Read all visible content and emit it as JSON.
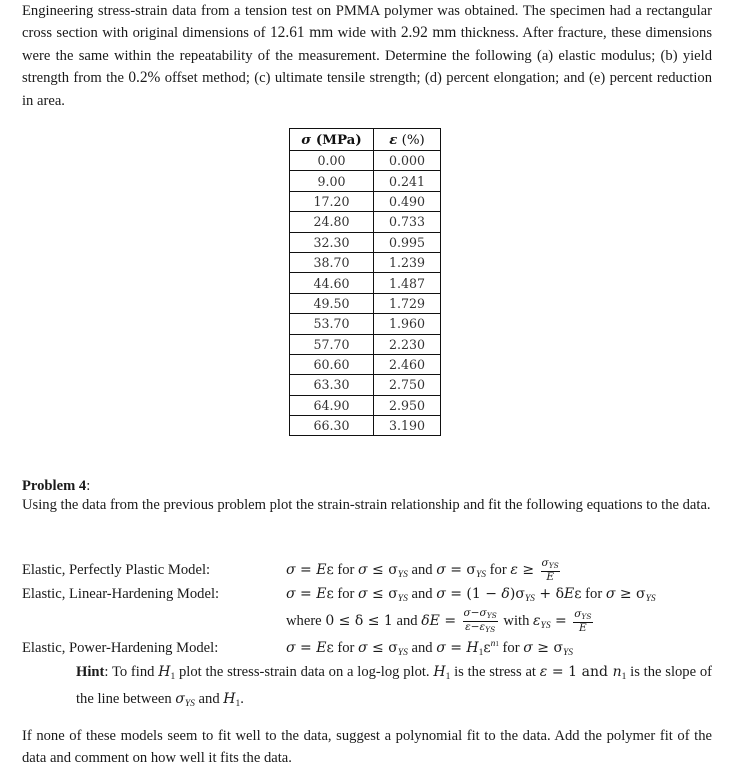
{
  "problem3": {
    "text_parts": [
      "Engineering stress-strain data from a tension test on PMMA polymer was obtained.  The specimen had a rectangular cross section with original dimensions of ",
      "12.61 mm",
      " wide with ",
      "2.92 mm",
      " thickness.  After fracture, these dimensions were the same within the repeatability of the measurement.  Determine the following (a) elastic modulus; (b) yield strength from the ",
      "0.2%",
      " offset method; (c) ultimate tensile strength; (d) percent elongation; and (e) percent reduction in area."
    ]
  },
  "table": {
    "headers": {
      "stress_symbol": "σ",
      "stress_unit": " (MPa)",
      "strain_symbol": "ε",
      "strain_unit": " (%)"
    },
    "rows": [
      [
        "0.00",
        "0.000"
      ],
      [
        "9.00",
        "0.241"
      ],
      [
        "17.20",
        "0.490"
      ],
      [
        "24.80",
        "0.733"
      ],
      [
        "32.30",
        "0.995"
      ],
      [
        "38.70",
        "1.239"
      ],
      [
        "44.60",
        "1.487"
      ],
      [
        "49.50",
        "1.729"
      ],
      [
        "53.70",
        "1.960"
      ],
      [
        "57.70",
        "2.230"
      ],
      [
        "60.60",
        "2.460"
      ],
      [
        "63.30",
        "2.750"
      ],
      [
        "64.90",
        "2.950"
      ],
      [
        "66.30",
        "3.190"
      ]
    ]
  },
  "problem4": {
    "title": "Problem 4",
    "title_suffix": ":",
    "intro": "Using the data from the previous problem plot the strain-strain relationship and fit the following equations to the data.",
    "models": [
      {
        "label": "Elastic, Perfectly Plastic Model:"
      },
      {
        "label": "Elastic, Linear-Hardening Model:"
      },
      {
        "label": "Elastic, Power-Hardening Model:"
      }
    ],
    "hint": {
      "label": "Hint",
      "parts": [
        ":  To find ",
        " plot the stress-strain data on a log-log plot.  ",
        " is the stress at ",
        " = 1 and ",
        " is the slope of the line between ",
        " and ",
        "."
      ]
    },
    "closing": "If none of these models seem to fit well to the data, suggest a polynomial fit to the data.  Add the polymer fit of the data and comment on how well it fits the data."
  },
  "math": {
    "for": " for ",
    "and": " and ",
    "where": "where ",
    "with": " with ",
    "sigma": "σ",
    "eps": "ε",
    "E": "E",
    "YS": "YS",
    "H": "H",
    "n": "n",
    "one": "1",
    "delta": "δ"
  }
}
